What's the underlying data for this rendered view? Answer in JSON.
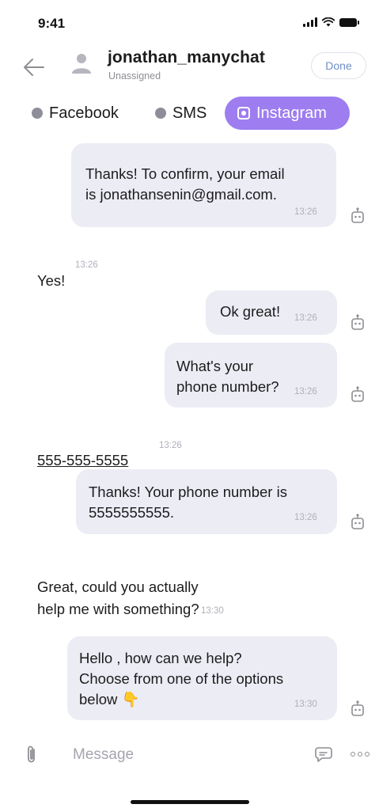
{
  "status_bar": {
    "time": "9:41"
  },
  "header": {
    "contact_name": "jonathan_manychat",
    "contact_status": "Unassigned",
    "done_label": "Done"
  },
  "channels": [
    {
      "label": "Facebook",
      "active": false
    },
    {
      "label": "SMS",
      "active": false
    },
    {
      "label": "Instagram",
      "active": true
    }
  ],
  "messages": [
    {
      "from": "bot",
      "text": "Thanks! To confirm, your email\nis jonathansenin@gmail.com.",
      "time": "13:26"
    },
    {
      "from": "user",
      "text": "Yes!",
      "time": "13:26"
    },
    {
      "from": "bot",
      "text": "Ok great!",
      "time": "13:26"
    },
    {
      "from": "bot",
      "text": "What's your\nphone number?",
      "time": "13:26"
    },
    {
      "from": "user",
      "text": "555-555-5555",
      "time": "13:26"
    },
    {
      "from": "bot",
      "text": "Thanks! Your phone number is\n5555555555.",
      "time": "13:26"
    },
    {
      "from": "user",
      "text": "Great, could you actually\nhelp me with something?",
      "time": "13:30"
    },
    {
      "from": "bot",
      "text": "Hello , how can we help?\nChoose from one of the options\nbelow 👇",
      "time": "13:30"
    }
  ],
  "composer": {
    "placeholder": "Message"
  },
  "icons": {
    "back": "arrow-left-icon",
    "avatar": "person-icon",
    "bot": "robot-icon",
    "attach": "paperclip-icon",
    "emoji": "chat-bubble-icon",
    "more": "more-dots-icon"
  },
  "colors": {
    "accent": "#9d7df0",
    "bubble": "#ececf4",
    "done_text": "#6e8fc7"
  }
}
